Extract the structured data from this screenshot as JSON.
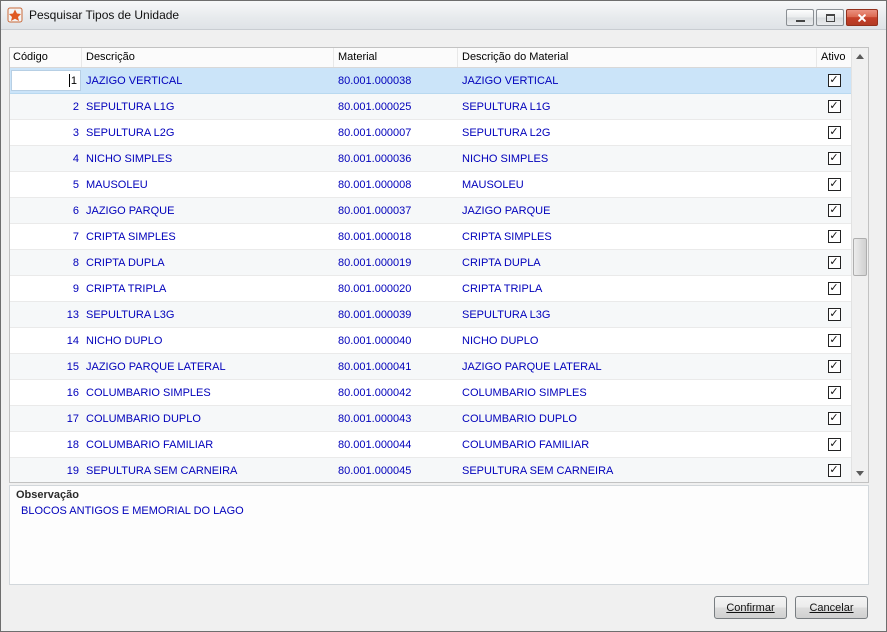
{
  "window": {
    "title": "Pesquisar Tipos de Unidade"
  },
  "table": {
    "columns": [
      "Código",
      "Descrição",
      "Material",
      "Descrição do Material",
      "Ativo"
    ],
    "selected_row_index": 0,
    "rows": [
      [
        "1",
        "JAZIGO VERTICAL",
        "80.001.000038",
        "JAZIGO VERTICAL",
        true
      ],
      [
        "2",
        "SEPULTURA L1G",
        "80.001.000025",
        "SEPULTURA L1G",
        true
      ],
      [
        "3",
        "SEPULTURA L2G",
        "80.001.000007",
        "SEPULTURA L2G",
        true
      ],
      [
        "4",
        "NICHO SIMPLES",
        "80.001.000036",
        "NICHO SIMPLES",
        true
      ],
      [
        "5",
        "MAUSOLEU",
        "80.001.000008",
        "MAUSOLEU",
        true
      ],
      [
        "6",
        "JAZIGO PARQUE",
        "80.001.000037",
        "JAZIGO PARQUE",
        true
      ],
      [
        "7",
        "CRIPTA SIMPLES",
        "80.001.000018",
        "CRIPTA SIMPLES",
        true
      ],
      [
        "8",
        "CRIPTA DUPLA",
        "80.001.000019",
        "CRIPTA DUPLA",
        true
      ],
      [
        "9",
        "CRIPTA TRIPLA",
        "80.001.000020",
        "CRIPTA TRIPLA",
        true
      ],
      [
        "13",
        "SEPULTURA L3G",
        "80.001.000039",
        "SEPULTURA L3G",
        true
      ],
      [
        "14",
        "NICHO DUPLO",
        "80.001.000040",
        "NICHO DUPLO",
        true
      ],
      [
        "15",
        "JAZIGO PARQUE LATERAL",
        "80.001.000041",
        "JAZIGO PARQUE LATERAL",
        true
      ],
      [
        "16",
        "COLUMBARIO SIMPLES",
        "80.001.000042",
        "COLUMBARIO SIMPLES",
        true
      ],
      [
        "17",
        "COLUMBARIO DUPLO",
        "80.001.000043",
        "COLUMBARIO DUPLO",
        true
      ],
      [
        "18",
        "COLUMBARIO FAMILIAR",
        "80.001.000044",
        "COLUMBARIO FAMILIAR",
        true
      ],
      [
        "19",
        "SEPULTURA SEM CARNEIRA",
        "80.001.000045",
        "SEPULTURA SEM CARNEIRA",
        true
      ]
    ],
    "checkbox_glyph": "✓"
  },
  "observacao": {
    "label": "Observação",
    "text": "BLOCOS ANTIGOS E MEMORIAL DO LAGO"
  },
  "buttons": {
    "confirmar": "Confirmar",
    "cancelar": "Cancelar"
  },
  "colors": {
    "row_text": "#0000BB",
    "selection": "#CBE4F9",
    "close_button": "#C6402A",
    "app_icon": "#E05A22"
  }
}
